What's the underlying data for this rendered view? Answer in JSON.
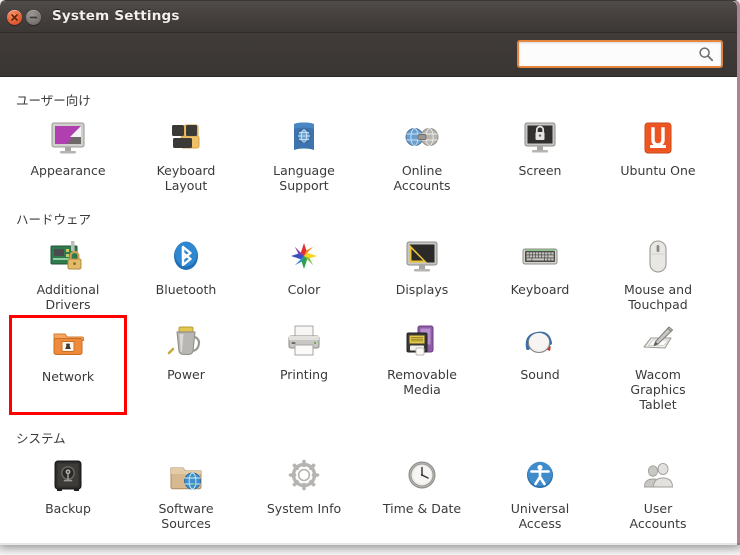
{
  "window": {
    "title": "System Settings",
    "close_label": "x",
    "minimize_label": "–"
  },
  "toolbar": {
    "search_value": "",
    "search_placeholder": "",
    "search_icon": "search-icon"
  },
  "groups": [
    {
      "id": "personal",
      "title": "ユーザー向け",
      "items": [
        {
          "label": "Appearance",
          "icon": "appearance-icon",
          "highlighted": false
        },
        {
          "label": "Keyboard\nLayout",
          "icon": "keyboard-layout-icon",
          "highlighted": false
        },
        {
          "label": "Language\nSupport",
          "icon": "language-support-icon",
          "highlighted": false
        },
        {
          "label": "Online\nAccounts",
          "icon": "online-accounts-icon",
          "highlighted": false
        },
        {
          "label": "Screen",
          "icon": "screen-lock-icon",
          "highlighted": false
        },
        {
          "label": "Ubuntu One",
          "icon": "ubuntu-one-icon",
          "highlighted": false
        }
      ]
    },
    {
      "id": "hardware",
      "title": "ハードウェア",
      "items": [
        {
          "label": "Additional\nDrivers",
          "icon": "additional-drivers-icon",
          "highlighted": false
        },
        {
          "label": "Bluetooth",
          "icon": "bluetooth-icon",
          "highlighted": false
        },
        {
          "label": "Color",
          "icon": "color-icon",
          "highlighted": false
        },
        {
          "label": "Displays",
          "icon": "displays-icon",
          "highlighted": false
        },
        {
          "label": "Keyboard",
          "icon": "keyboard-icon",
          "highlighted": false
        },
        {
          "label": "Mouse and\nTouchpad",
          "icon": "mouse-icon",
          "highlighted": false
        },
        {
          "label": "Network",
          "icon": "network-icon",
          "highlighted": true
        },
        {
          "label": "Power",
          "icon": "power-icon",
          "highlighted": false
        },
        {
          "label": "Printing",
          "icon": "printing-icon",
          "highlighted": false
        },
        {
          "label": "Removable\nMedia",
          "icon": "removable-media-icon",
          "highlighted": false
        },
        {
          "label": "Sound",
          "icon": "sound-icon",
          "highlighted": false
        },
        {
          "label": "Wacom\nGraphics\nTablet",
          "icon": "wacom-tablet-icon",
          "highlighted": false
        }
      ]
    },
    {
      "id": "system",
      "title": "システム",
      "items": [
        {
          "label": "Backup",
          "icon": "backup-icon",
          "highlighted": false
        },
        {
          "label": "Software\nSources",
          "icon": "software-sources-icon",
          "highlighted": false
        },
        {
          "label": "System Info",
          "icon": "system-info-icon",
          "highlighted": false
        },
        {
          "label": "Time & Date",
          "icon": "time-date-icon",
          "highlighted": false
        },
        {
          "label": "Universal\nAccess",
          "icon": "universal-access-icon",
          "highlighted": false
        },
        {
          "label": "User\nAccounts",
          "icon": "user-accounts-icon",
          "highlighted": false
        }
      ]
    }
  ],
  "colors": {
    "titlebar": "#443f3c",
    "accent_orange": "#e6853f",
    "highlight_red": "#ff0000",
    "ubuntu_orange": "#dd4814",
    "window_border": "#b08292"
  }
}
